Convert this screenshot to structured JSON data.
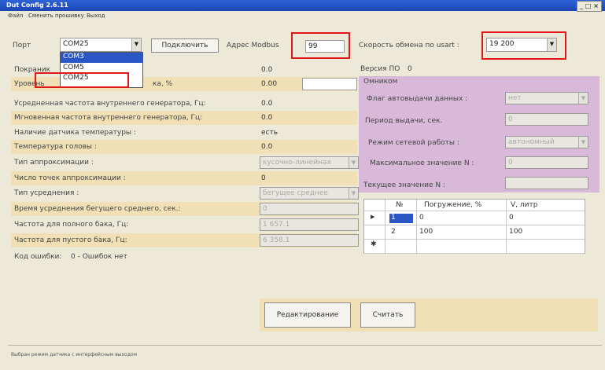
{
  "window": {
    "title": "Dut Config 2.6.11",
    "controls": "_ □ ×"
  },
  "menu": [
    "Файл",
    "Сменить прошивку",
    "Выход"
  ],
  "port": {
    "label": "Порт",
    "value": "COM25",
    "options": [
      "COM3",
      "COM5",
      "COM25"
    ]
  },
  "connect_button": "Подключить",
  "modbus": {
    "label": "Адрес Modbus",
    "value": "99"
  },
  "baud": {
    "label": "Скорость обмена по usart :",
    "value": "19 200"
  },
  "firmware": {
    "label": "Версия ПО",
    "value": "0"
  },
  "left_rows": [
    {
      "label": "Покраник",
      "value": "0.0"
    },
    {
      "label": "Уровень",
      "label2": "ка, %",
      "value": "0.00"
    },
    {
      "label": "Усредненная частота внутреннего генератора, Гц:",
      "value": "0.0"
    },
    {
      "label": "Мгновенная частота внутреннего генератора, Гц:",
      "value": "0.0"
    },
    {
      "label": "Наличие датчика температуры :",
      "value": "есть"
    },
    {
      "label": "Температура головы :",
      "value": "0.0"
    },
    {
      "label": "Тип аппроксимации :",
      "value": "кусочно-линейная"
    },
    {
      "label": "Число точек аппроксимации :",
      "value": "0"
    },
    {
      "label": "Тип усреднения :",
      "value": "бегущее среднее"
    },
    {
      "label": "Время усреднения бегущего среднего, сек.:",
      "value": "0"
    },
    {
      "label": "Частота для полного бака, Гц:",
      "value": "1 657.1"
    },
    {
      "label": "Частота для пустого бака, Гц:",
      "value": "6 358.1"
    },
    {
      "label": "Код ошибки:",
      "value": "0 - Ошибок нет"
    }
  ],
  "omnicomm": {
    "title": "Омником",
    "flag_label": "Флаг автовыдачи данных :",
    "flag_value": "нет",
    "period_label": "Период выдачи, сек.",
    "period_value": "0",
    "mode_label": "Режим сетевой работы :",
    "mode_value": "автономный",
    "maxn_label": "Максимальное значение N :",
    "maxn_value": "0",
    "curn_label": "Текущее значение N :",
    "curn_value": ""
  },
  "table": {
    "headers": [
      "№",
      "Погружение, %",
      "V, литр"
    ],
    "rows": [
      [
        "1",
        "0",
        "0"
      ],
      [
        "2",
        "100",
        "100"
      ]
    ]
  },
  "buttons": {
    "edit": "Редактирование",
    "read": "Считать"
  },
  "status": "Выбран режим датчика с интерфейсным выходом"
}
